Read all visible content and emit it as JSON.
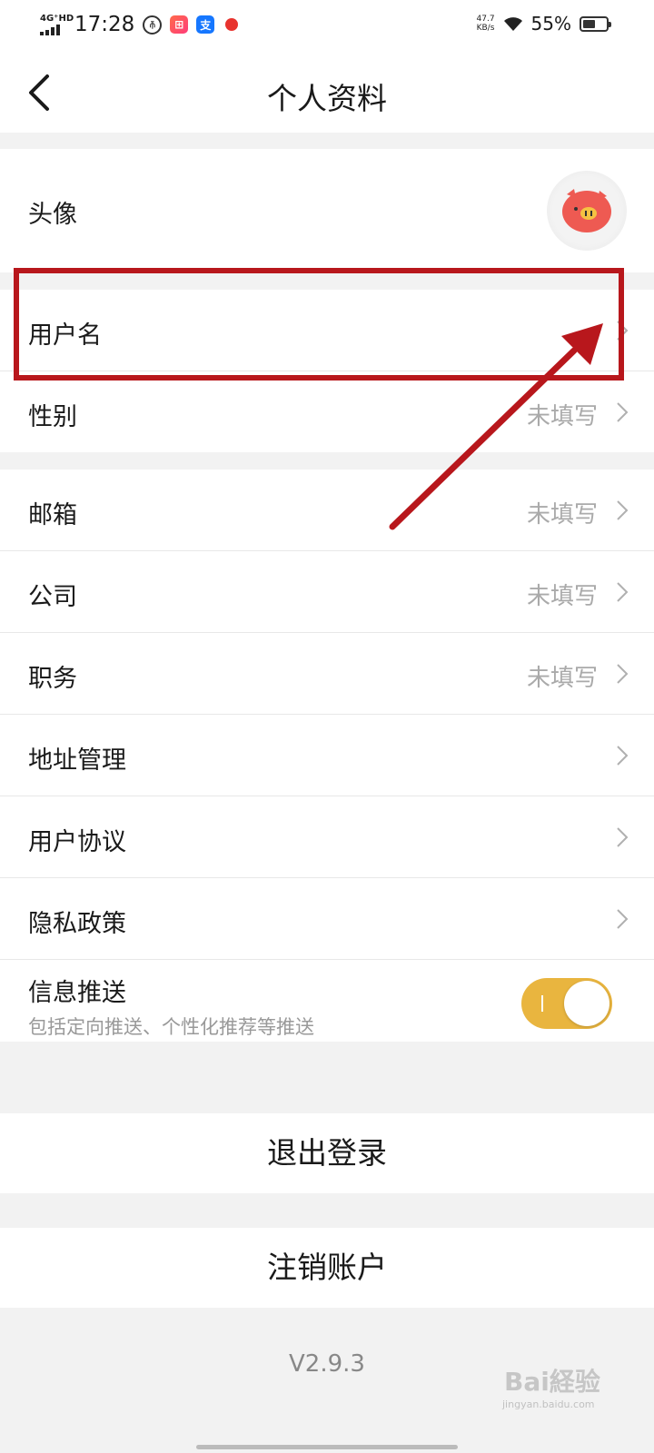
{
  "status_bar": {
    "network": "4G⁺HD",
    "time": "17:28",
    "speed_value": "47.7",
    "speed_unit": "KB/s",
    "battery_percent": "55%",
    "battery_level": 0.55,
    "app_icons": [
      "unicom-icon",
      "app-icon-red",
      "alipay-icon",
      "video-record-icon"
    ]
  },
  "nav": {
    "title": "个人资料",
    "back_icon": "chevron-left-icon"
  },
  "profile": {
    "avatar_label": "头像",
    "avatar_icon": "pig-avatar-icon",
    "rows_group1": [
      {
        "label": "用户名",
        "value": ""
      },
      {
        "label": "性别",
        "value": "未填写"
      }
    ],
    "rows_group2": [
      {
        "label": "邮箱",
        "value": "未填写"
      },
      {
        "label": "公司",
        "value": "未填写"
      },
      {
        "label": "职务",
        "value": "未填写"
      },
      {
        "label": "地址管理",
        "value": ""
      },
      {
        "label": "用户协议",
        "value": ""
      },
      {
        "label": "隐私政策",
        "value": ""
      }
    ],
    "push": {
      "label": "信息推送",
      "description": "包括定向推送、个性化推荐等推送",
      "enabled": true
    }
  },
  "actions": {
    "logout_label": "退出登录",
    "cancel_account_label": "注销账户"
  },
  "version": "V2.9.3",
  "watermark": {
    "text": "Bai経验",
    "sub": "jingyan.baidu.com"
  },
  "colors": {
    "accent_toggle": "#e9b53f",
    "annotation_red": "#b8171c",
    "value_gray": "#aaaaaa"
  }
}
